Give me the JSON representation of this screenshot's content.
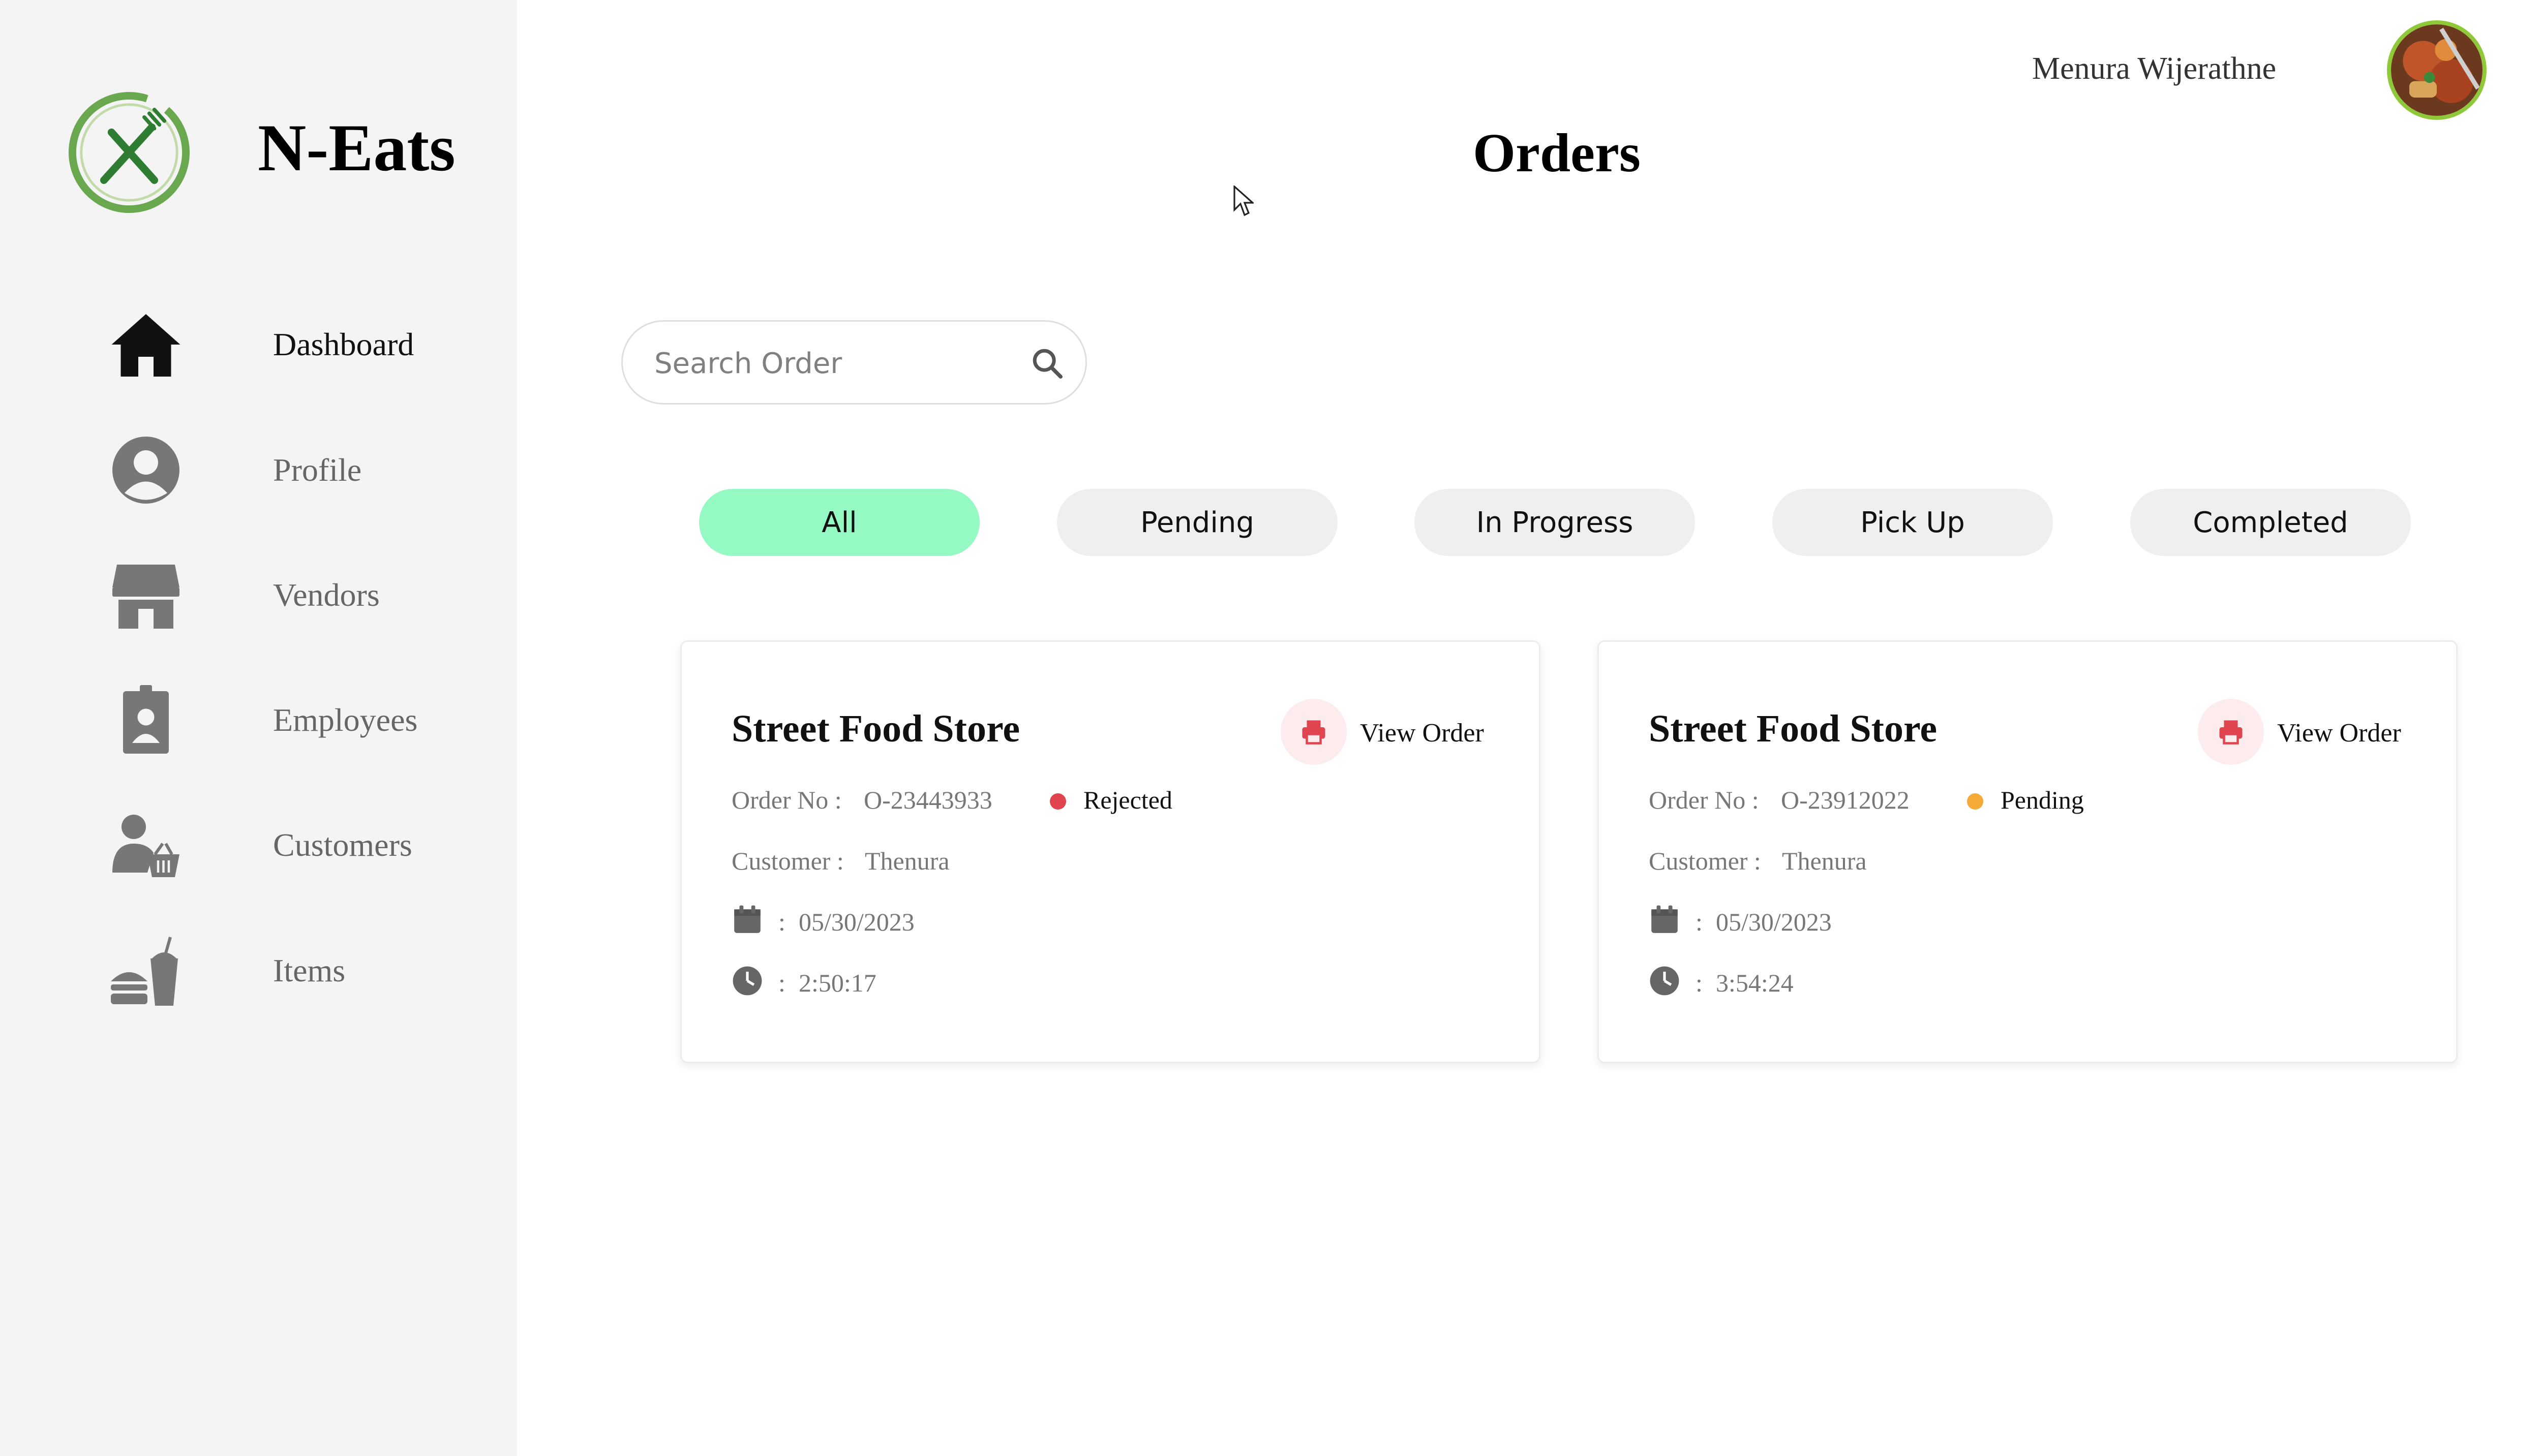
{
  "app": {
    "brand": "N-Eats",
    "accent_color": "#95f9c3",
    "logo_color": "#6aa84f",
    "logo_icon": "fork-knife-icon"
  },
  "sidebar": {
    "items": [
      {
        "label": "Dashboard",
        "icon": "home-icon",
        "active": true
      },
      {
        "label": "Profile",
        "icon": "user-circle-icon",
        "active": false
      },
      {
        "label": "Vendors",
        "icon": "store-icon",
        "active": false
      },
      {
        "label": "Employees",
        "icon": "id-badge-icon",
        "active": false
      },
      {
        "label": "Customers",
        "icon": "user-basket-icon",
        "active": false
      },
      {
        "label": "Items",
        "icon": "food-drink-icon",
        "active": false
      }
    ]
  },
  "header": {
    "user_name": "Menura Wijerathne",
    "avatar_icon": "avatar-image",
    "page_title": "Orders"
  },
  "search": {
    "placeholder": "Search Order",
    "value": ""
  },
  "filters": {
    "tabs": [
      {
        "label": "All",
        "active": true
      },
      {
        "label": "Pending",
        "active": false
      },
      {
        "label": "In Progress",
        "active": false
      },
      {
        "label": "Pick Up",
        "active": false
      },
      {
        "label": "Completed",
        "active": false
      }
    ]
  },
  "orders": [
    {
      "store": "Street Food Store",
      "view_label": "View Order",
      "order_no_label": "Order No :",
      "order_no": "O-23443933",
      "status": "Rejected",
      "status_color": "#e0454f",
      "customer_label": "Customer :",
      "customer": "Thenura",
      "date_sep": ":",
      "date": "05/30/2023",
      "time_sep": ":",
      "time": "2:50:17"
    },
    {
      "store": "Street Food Store",
      "view_label": "View Order",
      "order_no_label": "Order No :",
      "order_no": "O-23912022",
      "status": "Pending",
      "status_color": "#f5a937",
      "customer_label": "Customer :",
      "customer": "Thenura",
      "date_sep": ":",
      "date": "05/30/2023",
      "time_sep": ":",
      "time": "3:54:24"
    }
  ]
}
